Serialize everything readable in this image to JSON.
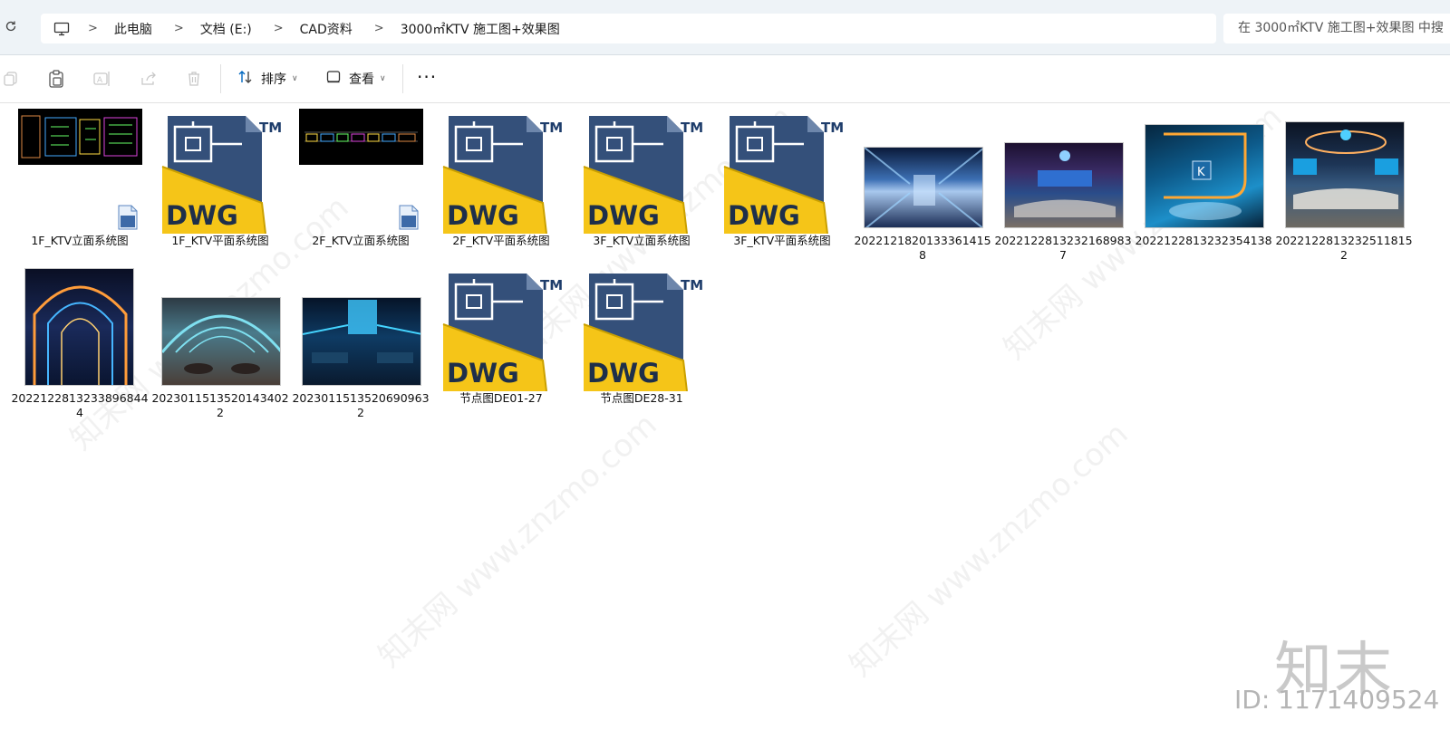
{
  "breadcrumb": {
    "items": [
      "此电脑",
      "文档 (E:)",
      "CAD资料",
      "3000㎡KTV 施工图+效果图"
    ]
  },
  "search": {
    "placeholder": "在 3000㎡KTV 施工图+效果图 中搜"
  },
  "toolbar": {
    "sort_label": "排序",
    "view_label": "查看",
    "more_label": "···"
  },
  "files": [
    {
      "name": "1F_KTV立面系统图",
      "kind": "cad-thumb"
    },
    {
      "name": "1F_KTV平面系统图",
      "kind": "dwg"
    },
    {
      "name": "2F_KTV立面系统图",
      "kind": "cad-thumb"
    },
    {
      "name": "2F_KTV平面系统图",
      "kind": "dwg"
    },
    {
      "name": "3F_KTV立面系统图",
      "kind": "dwg"
    },
    {
      "name": "3F_KTV平面系统图",
      "kind": "dwg"
    },
    {
      "name": "20221218201333614158",
      "kind": "image"
    },
    {
      "name": "20221228132321689837",
      "kind": "image"
    },
    {
      "name": "2022122813232354138",
      "kind": "image"
    },
    {
      "name": "20221228132325118152",
      "kind": "image"
    },
    {
      "name": "20221228132338968444",
      "kind": "image"
    },
    {
      "name": "20230115135201434022",
      "kind": "image"
    },
    {
      "name": "20230115135206909632",
      "kind": "image"
    },
    {
      "name": "节点图DE01-27",
      "kind": "dwg"
    },
    {
      "name": "节点图DE28-31",
      "kind": "dwg"
    }
  ],
  "dwg_icon": {
    "badge_text": "DWG",
    "tm_text": "TM"
  },
  "watermark": {
    "text": "知末网 www.znzmo.com",
    "logo": "知末",
    "id_text": "ID: 1171409524"
  },
  "colors": {
    "dwg_yellow": "#f5c518",
    "dwg_blue": "#34507a",
    "accent": "#0067c0"
  }
}
